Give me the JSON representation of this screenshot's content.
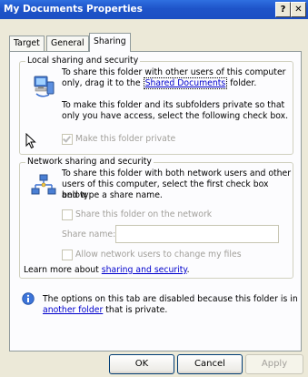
{
  "window": {
    "title": "My Documents Properties",
    "help_label": "?",
    "close_label": "✕"
  },
  "tabs": [
    {
      "label": "Target",
      "active": false
    },
    {
      "label": "General",
      "active": false
    },
    {
      "label": "Sharing",
      "active": true
    }
  ],
  "local_sharing": {
    "legend": "Local sharing and security",
    "text1_part1": "To share this folder with other users of this computer",
    "text1_part2": "only, drag it to the",
    "shared_docs_link": "Shared Documents",
    "text1_part3": "folder.",
    "text2_line1": "To make this folder and its subfolders private so that",
    "text2_line2": "only you have access, select the following check box.",
    "private_checkbox_label": "Make this folder private",
    "private_checked": true
  },
  "network_sharing": {
    "legend": "Network sharing and security",
    "text_line1": "To share this folder with both network users and other",
    "text_line2": "users of this computer, select the first check box below",
    "text_line3": "and type a share name.",
    "share_checkbox_label": "Share this folder on the network",
    "share_name_label": "Share name:",
    "share_name_value": "",
    "allow_change_label": "Allow network users to change my files",
    "learn_more_prefix": "Learn more about",
    "learn_more_link": "sharing and security",
    "learn_more_suffix": "."
  },
  "info": {
    "text_line1": "The options on this tab are disabled because this folder is in",
    "link": "another folder",
    "text_line2_suffix": "that is private."
  },
  "buttons": {
    "ok": "OK",
    "cancel": "Cancel",
    "apply": "Apply"
  },
  "colors": {
    "title_bar": "#1e54c9",
    "dialog_bg": "#ece9d8",
    "link": "#0000cc",
    "disabled_text": "#a19f9a"
  }
}
